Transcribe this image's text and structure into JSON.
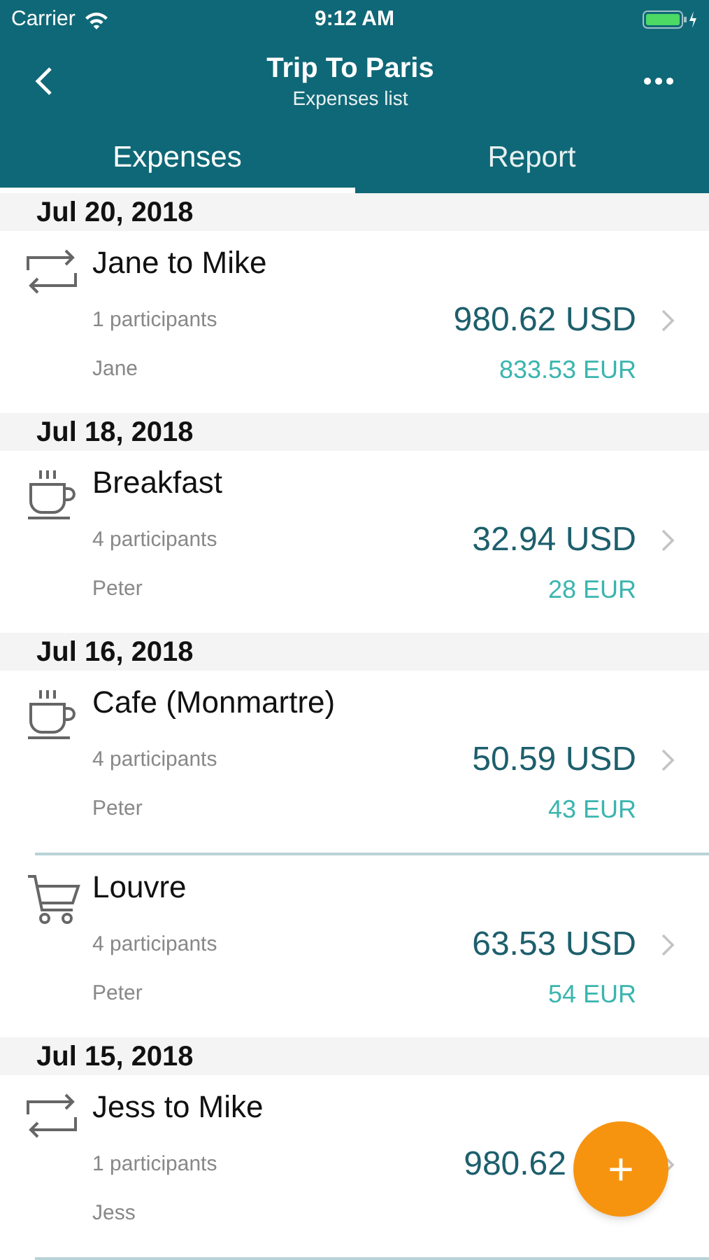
{
  "status_bar": {
    "carrier": "Carrier",
    "time": "9:12 AM"
  },
  "header": {
    "title": "Trip To Paris",
    "subtitle": "Expenses list"
  },
  "tabs": [
    {
      "label": "Expenses",
      "selected": true
    },
    {
      "label": "Report",
      "selected": false
    }
  ],
  "groups": [
    {
      "date": "Jul 20, 2018",
      "expenses": [
        {
          "kind": "transfer",
          "title": "Jane to Mike",
          "participants": "1 participants",
          "payer": "Jane",
          "amount": "980.62 USD",
          "converted": "833.53 EUR"
        }
      ]
    },
    {
      "date": "Jul 18, 2018",
      "expenses": [
        {
          "kind": "coffee",
          "title": "Breakfast",
          "participants": "4 participants",
          "payer": "Peter",
          "amount": "32.94 USD",
          "converted": "28 EUR"
        }
      ]
    },
    {
      "date": "Jul 16, 2018",
      "expenses": [
        {
          "kind": "coffee",
          "title": "Cafe (Monmartre)",
          "participants": "4 participants",
          "payer": "Peter",
          "amount": "50.59 USD",
          "converted": "43 EUR"
        },
        {
          "kind": "cart",
          "title": "Louvre",
          "participants": "4 participants",
          "payer": "Peter",
          "amount": "63.53 USD",
          "converted": "54 EUR"
        }
      ]
    },
    {
      "date": "Jul 15, 2018",
      "expenses": [
        {
          "kind": "transfer",
          "title": "Jess to Mike",
          "participants": "1 participants",
          "payer": "Jess",
          "amount": "980.62"
        }
      ]
    }
  ],
  "add_button": {
    "label": "+"
  }
}
